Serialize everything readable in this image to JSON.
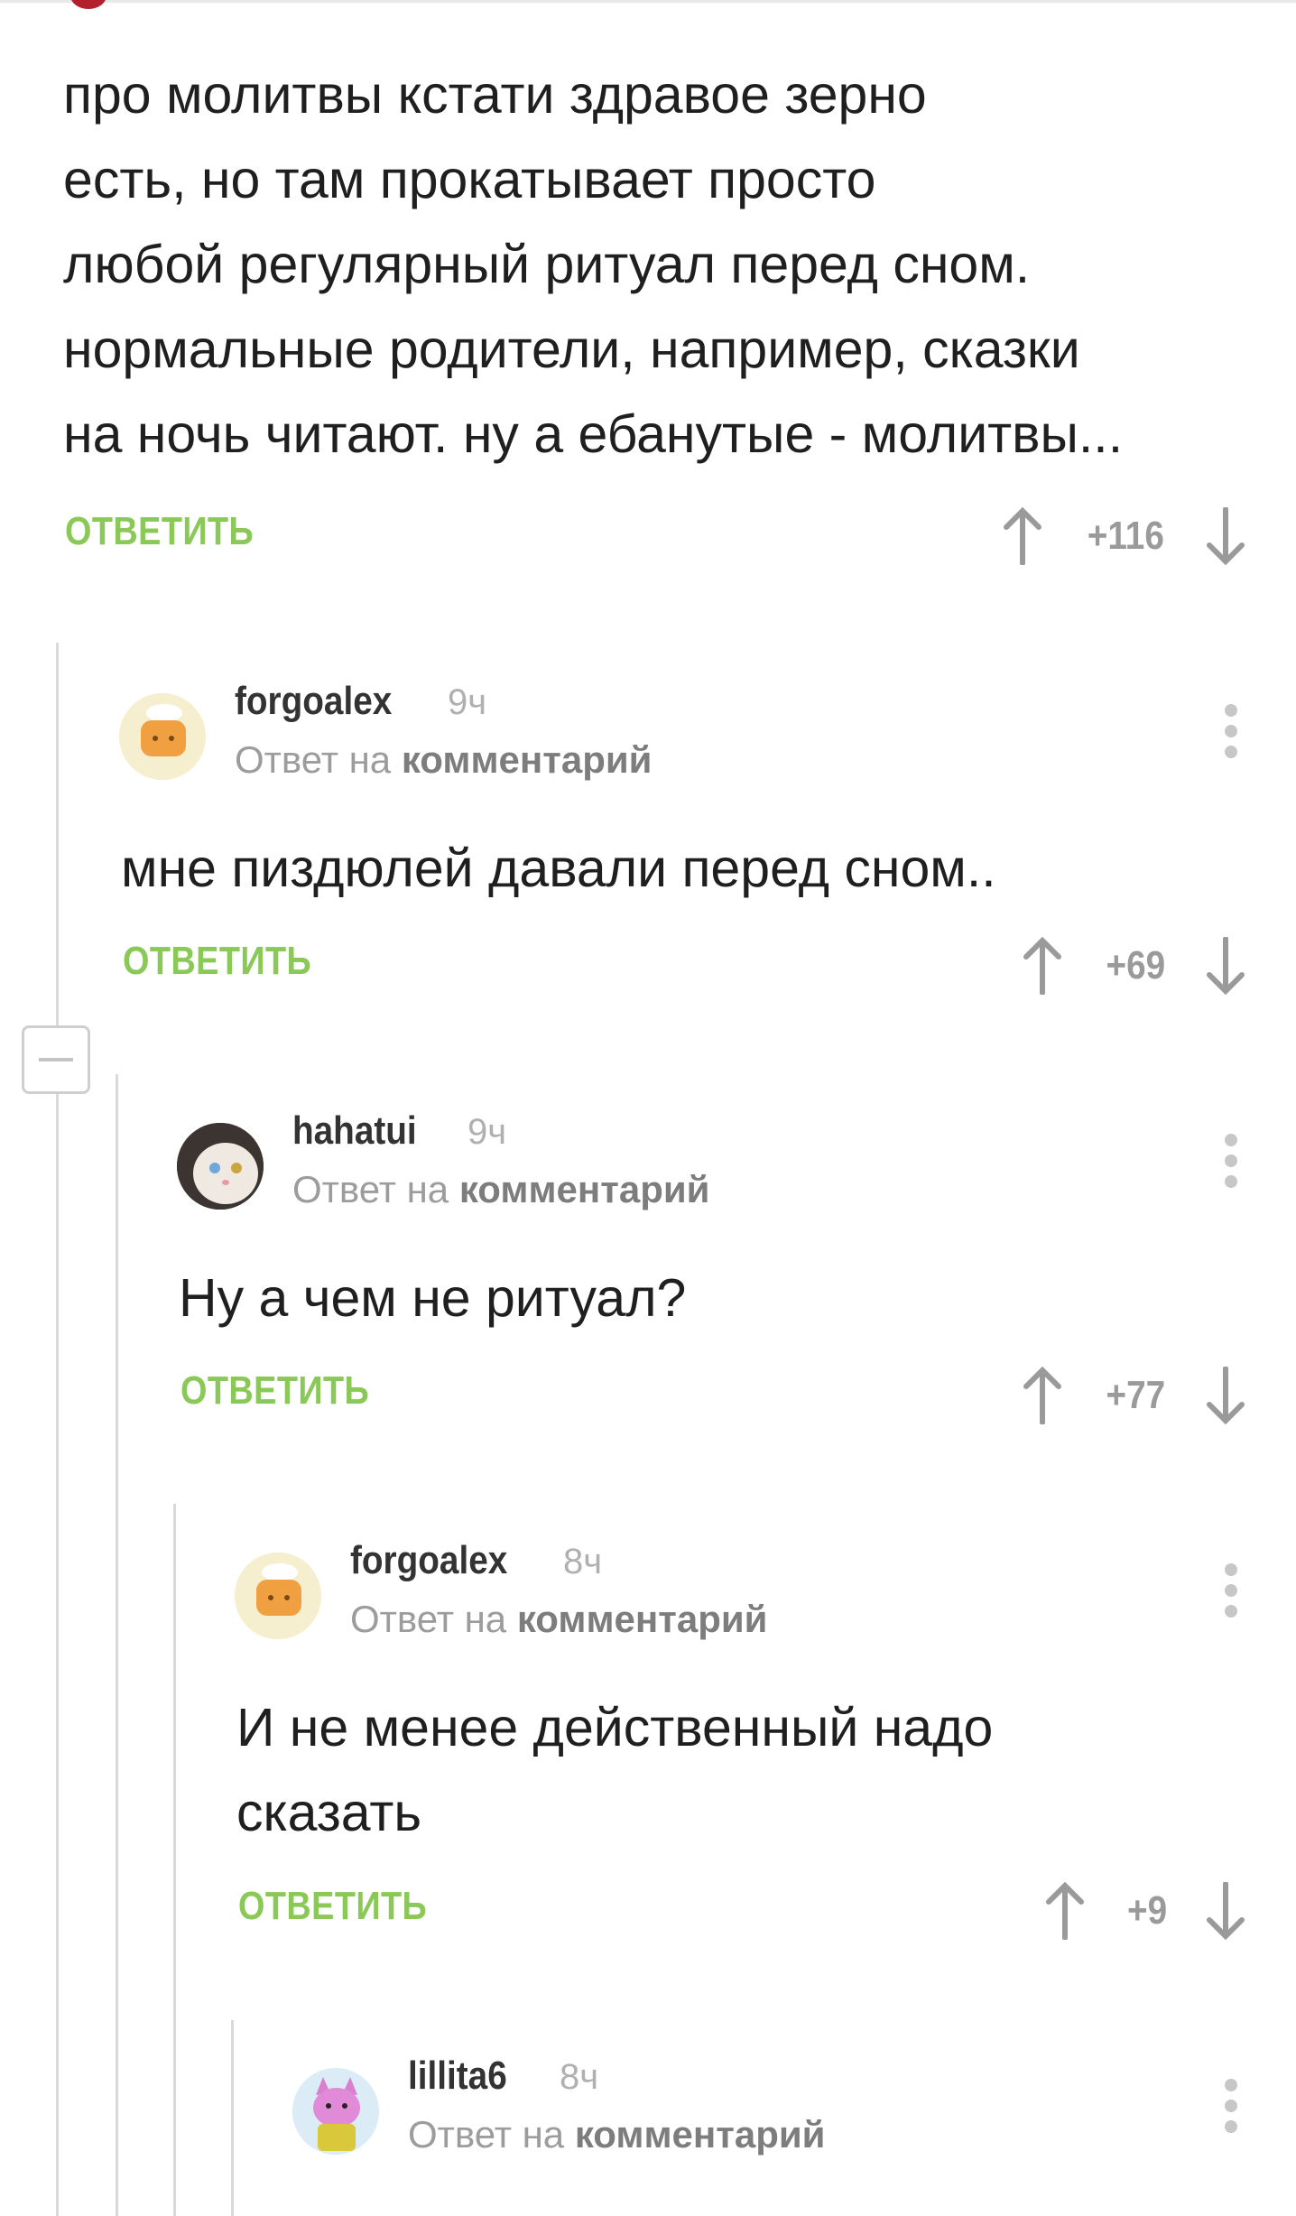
{
  "root": {
    "body": "про молитвы кстати здравое зерно\nесть, но там прокатывает просто\nлюбой регулярный ритуал перед сном.\nнормальные родители, например, сказки\nна ночь читают. ну а ебанутые - молитвы...",
    "reply_label": "ОТВЕТИТЬ",
    "score": "+116"
  },
  "comments": [
    {
      "author": "forgoalex",
      "time": "9ч",
      "reply_prefix": "Ответ на",
      "reply_target": "комментарий",
      "body": "мне пиздюлей давали перед сном..",
      "reply_label": "ОТВЕТИТЬ",
      "score": "+69",
      "avatar": "chef-avatar"
    },
    {
      "author": "hahatui",
      "time": "9ч",
      "reply_prefix": "Ответ на",
      "reply_target": "комментарий",
      "body": "Ну а чем не ритуал?",
      "reply_label": "ОТВЕТИТЬ",
      "score": "+77",
      "avatar": "cat-avatar"
    },
    {
      "author": "forgoalex",
      "time": "8ч",
      "reply_prefix": "Ответ на",
      "reply_target": "комментарий",
      "body": "И не менее действенный надо\nсказать",
      "reply_label": "ОТВЕТИТЬ",
      "score": "+9",
      "avatar": "chef-avatar"
    },
    {
      "author": "lillita6",
      "time": "8ч",
      "reply_prefix": "Ответ на",
      "reply_target": "комментарий",
      "avatar": "pink-cat-avatar"
    }
  ],
  "colors": {
    "accent": "#8ac858",
    "muted": "#9a9a9a",
    "thread_line": "#d9d9d9"
  },
  "icons": [
    "arrow-up-icon",
    "arrow-down-icon",
    "kebab-menu-icon",
    "collapse-icon"
  ]
}
